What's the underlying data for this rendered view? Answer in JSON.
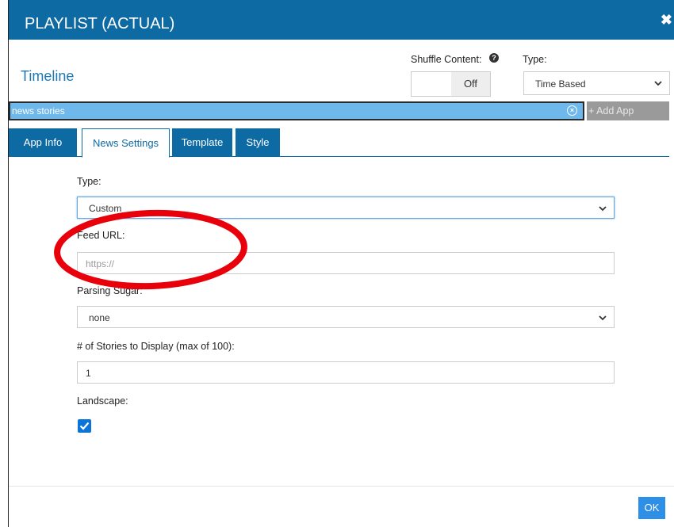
{
  "header": {
    "title": "PLAYLIST (ACTUAL)",
    "close_glyph": "✖"
  },
  "timeline": {
    "title": "Timeline"
  },
  "shuffle": {
    "label": "Shuffle Content:",
    "help_glyph": "?",
    "state_label": "Off"
  },
  "playlist_type": {
    "label": "Type:",
    "value": "Time Based"
  },
  "search": {
    "value": "news stories",
    "clear_glyph": "×",
    "add_app_label": "+ Add App"
  },
  "tabs": [
    {
      "label": "App Info"
    },
    {
      "label": "News Settings"
    },
    {
      "label": "Template"
    },
    {
      "label": "Style"
    }
  ],
  "form": {
    "type_label": "Type:",
    "type_value": "Custom",
    "feed_url_label": "Feed URL:",
    "feed_url_placeholder": "https://",
    "parsing_label": "Parsing Sugar:",
    "parsing_value": "none",
    "stories_label": "# of Stories to Display (max of 100):",
    "stories_value": "1",
    "landscape_label": "Landscape:",
    "landscape_checked": true
  },
  "footer": {
    "ok_label": "OK"
  },
  "colors": {
    "brand": "#0e6aa3",
    "search_bg": "#6fb8ec",
    "checkbox": "#0a74d8",
    "ok": "#2d8fe6",
    "annotation": "#e8000b"
  }
}
